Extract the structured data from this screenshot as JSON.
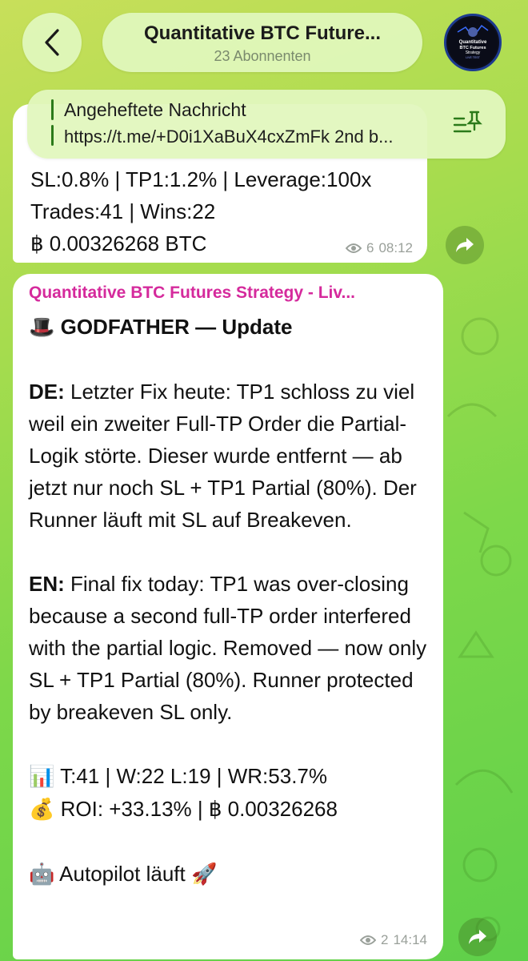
{
  "header": {
    "back_icon": "chevron-left-icon",
    "title": "Quantitative BTC Future...",
    "subtitle": "23 Abonnenten",
    "avatar_text": [
      "Quantitative",
      "BTC Futures",
      "Strategy",
      "LIVE TEST"
    ]
  },
  "pinned": {
    "label": "Angeheftete Nachricht",
    "text": "https://t.me/+D0i1XaBuX4cxZmFk 2nd b...",
    "icon": "pin-list-icon"
  },
  "message1": {
    "lines": [
      "SL:0.8% | TP1:1.2% | Leverage:100x",
      "Trades:41 | Wins:22",
      "฿ 0.00326268 BTC"
    ],
    "views": "6",
    "time": "08:12"
  },
  "message2": {
    "sender": "Quantitative BTC Futures Strategy - Liv...",
    "title_emoji": "🎩",
    "title": "GODFATHER — Update",
    "de_label": "DE:",
    "de_text": "Letzter Fix heute: TP1 schloss zu viel weil ein zweiter Full-TP Order die Partial-Logik störte. Dieser wurde entfernt — ab jetzt nur noch SL + TP1 Partial (80%). Der Runner läuft mit SL auf Breakeven.",
    "en_label": "EN:",
    "en_text": "Final fix today: TP1 was over-closing because a second full-TP order interfered with the partial logic. Removed — now only SL + TP1 Partial (80%). Runner protected by breakeven SL only.",
    "stats_emoji": "📊",
    "stats": "T:41 | W:22 L:19 | WR:53.7%",
    "roi_emoji": "💰",
    "roi": "ROI: +33.13% | ฿ 0.00326268",
    "status_emoji": "🤖",
    "status": "Autopilot läuft",
    "status_emoji2": "🚀",
    "views": "2",
    "time": "14:14"
  },
  "colors": {
    "sender": "#d52a9c",
    "pill_bg": "#e1f7be",
    "bubble_bg": "#ffffff"
  }
}
